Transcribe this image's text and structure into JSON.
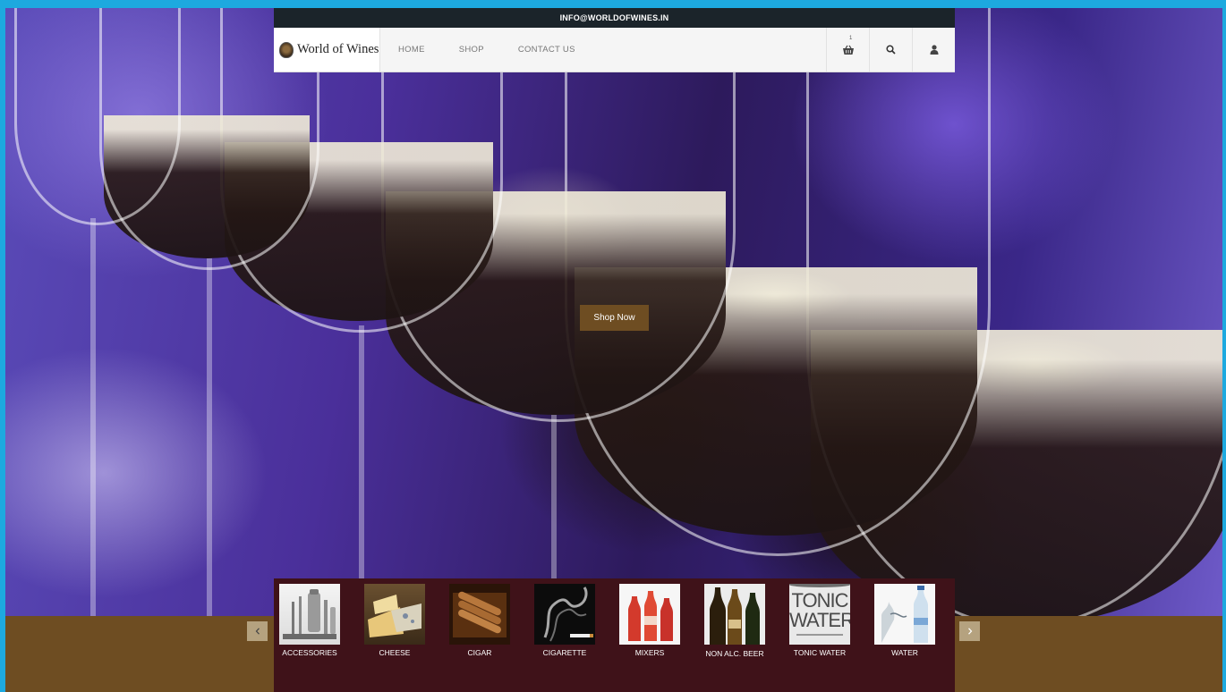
{
  "topbar": {
    "email": "INFO@WORLDOFWINES.IN"
  },
  "nav": {
    "logo_text": "World of Wines",
    "links": [
      "HOME",
      "SHOP",
      "CONTACT US"
    ],
    "cart_count": "1"
  },
  "hero": {
    "cta_label": "Shop Now"
  },
  "categories": [
    {
      "label": "ACCESSORIES"
    },
    {
      "label": "CHEESE"
    },
    {
      "label": "CIGAR"
    },
    {
      "label": "CIGARETTE"
    },
    {
      "label": "MIXERS"
    },
    {
      "label": "NON ALC. BEER"
    },
    {
      "label": "TONIC WATER",
      "thumb_text_top": "TONIC",
      "thumb_text_bottom": "WATER"
    },
    {
      "label": "WATER"
    }
  ],
  "colors": {
    "accent_brown": "#6e4d22",
    "carousel_bg": "#3f1219",
    "topbar_bg": "#1b242a",
    "page_frame": "#1da9df"
  }
}
